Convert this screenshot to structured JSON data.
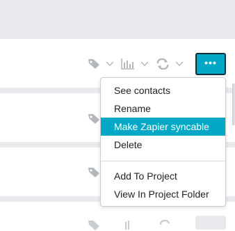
{
  "colors": {
    "accent": "#00a8c6",
    "icon_gray": "#b3b7bc",
    "separator": "#e8eaed"
  },
  "toolbar": {
    "icons": [
      "tag-icon",
      "chevron-down-icon",
      "bar-chart-icon",
      "chevron-down-icon",
      "sync-icon",
      "chevron-down-icon"
    ],
    "more_label": "•••"
  },
  "menu": {
    "items": [
      {
        "label": "See contacts"
      },
      {
        "label": "Rename"
      },
      {
        "label": "Make Zapier syncable",
        "active": true
      },
      {
        "label": "Delete"
      },
      {
        "label": "Add To Project"
      },
      {
        "label": "View In Project Folder"
      }
    ]
  }
}
